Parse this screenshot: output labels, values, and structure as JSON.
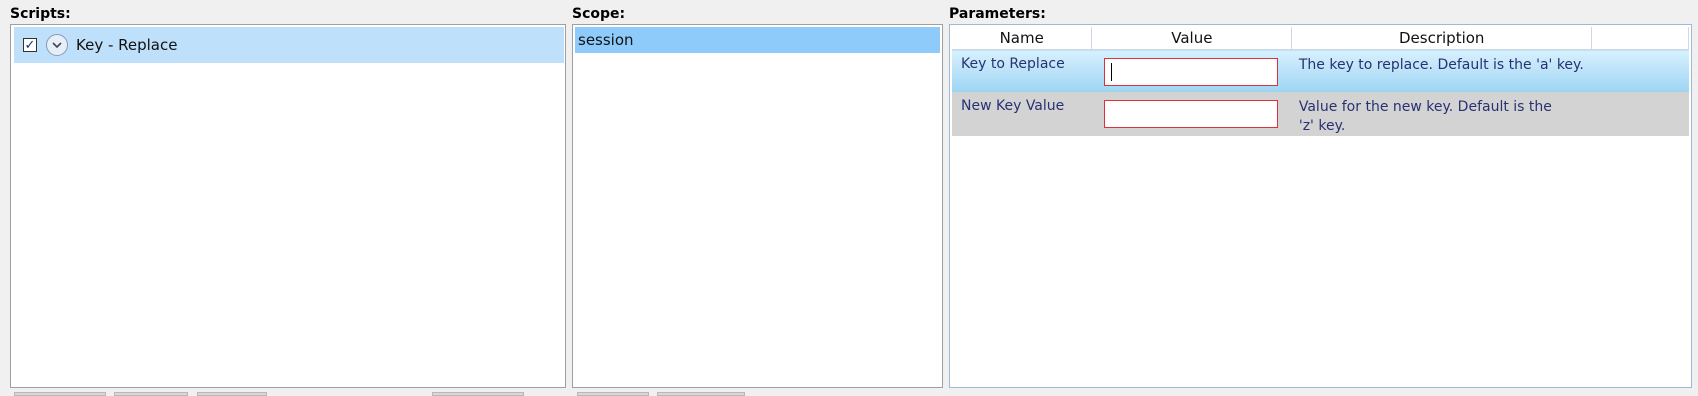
{
  "scripts": {
    "title": "Scripts:",
    "items": [
      {
        "checked": true,
        "checkmark": "✓",
        "label": "Key - Replace",
        "expand_icon": "chevron-down-circle-icon"
      }
    ]
  },
  "scope": {
    "title": "Scope:",
    "items": [
      "session"
    ]
  },
  "parameters": {
    "title": "Parameters:",
    "columns": {
      "name": "Name",
      "value": "Value",
      "description": "Description"
    },
    "rows": [
      {
        "name": "Key to Replace",
        "value": "",
        "description": "The key to replace. Default is the 'a' key."
      },
      {
        "name": "New Key Value",
        "value": "",
        "description": "Value for the new key. Default is the 'z' key."
      }
    ]
  },
  "colors": {
    "selected_script": "#bfe0fb",
    "selected_scope": "#8ecbfb",
    "invalid_border": "#d9343b",
    "row_alt": "#d3d3d3"
  }
}
